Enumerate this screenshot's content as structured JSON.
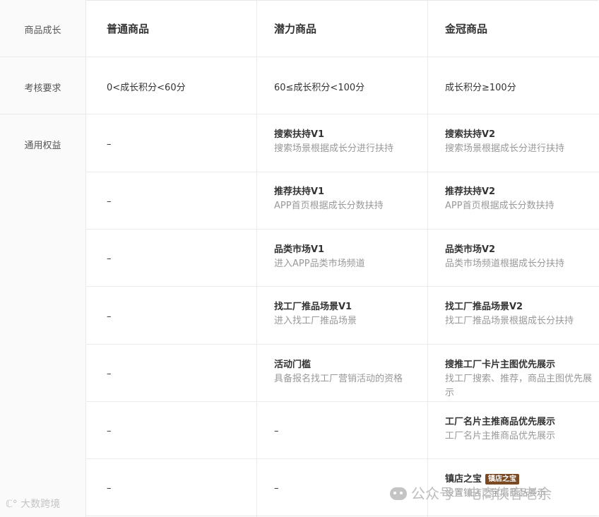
{
  "header": {
    "corner": "商品成长",
    "col1": "普通商品",
    "col2": "潜力商品",
    "col3": "金冠商品"
  },
  "requirements": {
    "label": "考核要求",
    "col1": "0<成长积分<60分",
    "col2": "60≤成长积分<100分",
    "col3": "成长积分≥100分"
  },
  "benefits": {
    "label": "通用权益",
    "rows": [
      {
        "col1": "–",
        "col2_title": "搜索扶持V1",
        "col2_desc": "搜索场景根据成长分进行扶持",
        "col3_title": "搜索扶持V2",
        "col3_desc": "搜索场景根据成长分进行扶持"
      },
      {
        "col1": "–",
        "col2_title": "推荐扶持V1",
        "col2_desc": "APP首页根据成长分数扶持",
        "col3_title": "推荐扶持V2",
        "col3_desc": "APP首页根据成长分数扶持"
      },
      {
        "col1": "–",
        "col2_title": "品类市场V1",
        "col2_desc": "进入APP品类市场频道",
        "col3_title": "品类市场V2",
        "col3_desc": "品类市场频道根据成长分扶持"
      },
      {
        "col1": "–",
        "col2_title": "找工厂推品场景V1",
        "col2_desc": "进入找工厂推品场景",
        "col3_title": "找工厂推品场景V2",
        "col3_desc": "找工厂推品场景根据成长分扶持"
      },
      {
        "col1": "–",
        "col2_title": "活动门槛",
        "col2_desc": "具备报名找工厂营销活动的资格",
        "col3_title": "搜推工厂卡片主图优先展示",
        "col3_desc": "找工厂搜索、推荐，商品主图优先展示"
      },
      {
        "col1": "–",
        "col2": "–",
        "col3_title": "工厂名片主推商品优先展示",
        "col3_desc": "工厂名片主推商品优先展示"
      },
      {
        "col1": "–",
        "col2": "–",
        "col3_title": "镇店之宝",
        "col3_tag": "镇店之宝",
        "col3_desc": "设置镇店之宝后商品展示"
      }
    ]
  },
  "watermarks": {
    "left": "大数跨境",
    "right": "公众号 · 电商侠客老余"
  }
}
